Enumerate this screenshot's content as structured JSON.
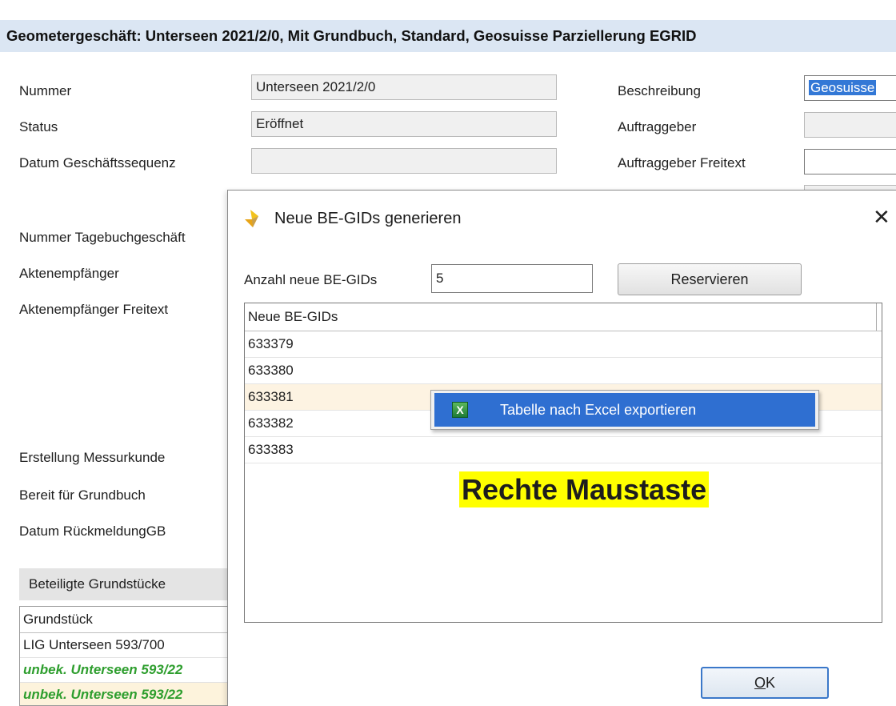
{
  "title": "Geometergeschäft: Unterseen 2021/2/0, Mit Grundbuch, Standard, Geosuisse Parziellerung EGRID",
  "form": {
    "nummer_label": "Nummer",
    "nummer_value": "Unterseen 2021/2/0",
    "status_label": "Status",
    "status_value": "Eröffnet",
    "datum_seq_label": "Datum Geschäftssequenz",
    "datum_seq_value": "",
    "beschreibung_label": "Beschreibung",
    "beschreibung_value": "Geosuisse",
    "auftraggeber_label": "Auftraggeber",
    "auftraggeber_value": "",
    "auftraggeber_freitext_label": "Auftraggeber Freitext",
    "auftraggeber_freitext_value": "",
    "tagebuch_label": "Nummer Tagebuchgeschäft",
    "aktenempfaenger_label": "Aktenempfänger",
    "aktenempfaenger_freitext_label": "Aktenempfänger Freitext",
    "messurkunde_label": "Erstellung Messurkunde",
    "bereit_label": "Bereit für Grundbuch",
    "rueckmeldung_label": "Datum RückmeldungGB"
  },
  "grundstuecke": {
    "section_title": "Beteiligte Grundstücke",
    "column": "Grundstück",
    "rows": [
      "LIG Unterseen 593/700",
      "unbek. Unterseen 593/22",
      "unbek. Unterseen 593/22"
    ]
  },
  "dialog": {
    "title": "Neue BE-GIDs generieren",
    "close_glyph": "✕",
    "count_label": "Anzahl neue BE-GIDs",
    "count_value": "5",
    "reserve_button": "Reservieren",
    "table_header": "Neue BE-GIDs",
    "rows": [
      "633379",
      "633380",
      "633381",
      "633382",
      "633383"
    ],
    "ok_button": "OK"
  },
  "context_menu": {
    "item_label": "Tabelle nach Excel exportieren",
    "item_icon": "excel-icon"
  },
  "annotation": "Rechte Maustaste",
  "colors": {
    "title_bar": "#dbe6f3",
    "menu_highlight": "#2f6fd1",
    "annotation_bg": "#ffff00",
    "green_text": "#2e9e2e"
  }
}
